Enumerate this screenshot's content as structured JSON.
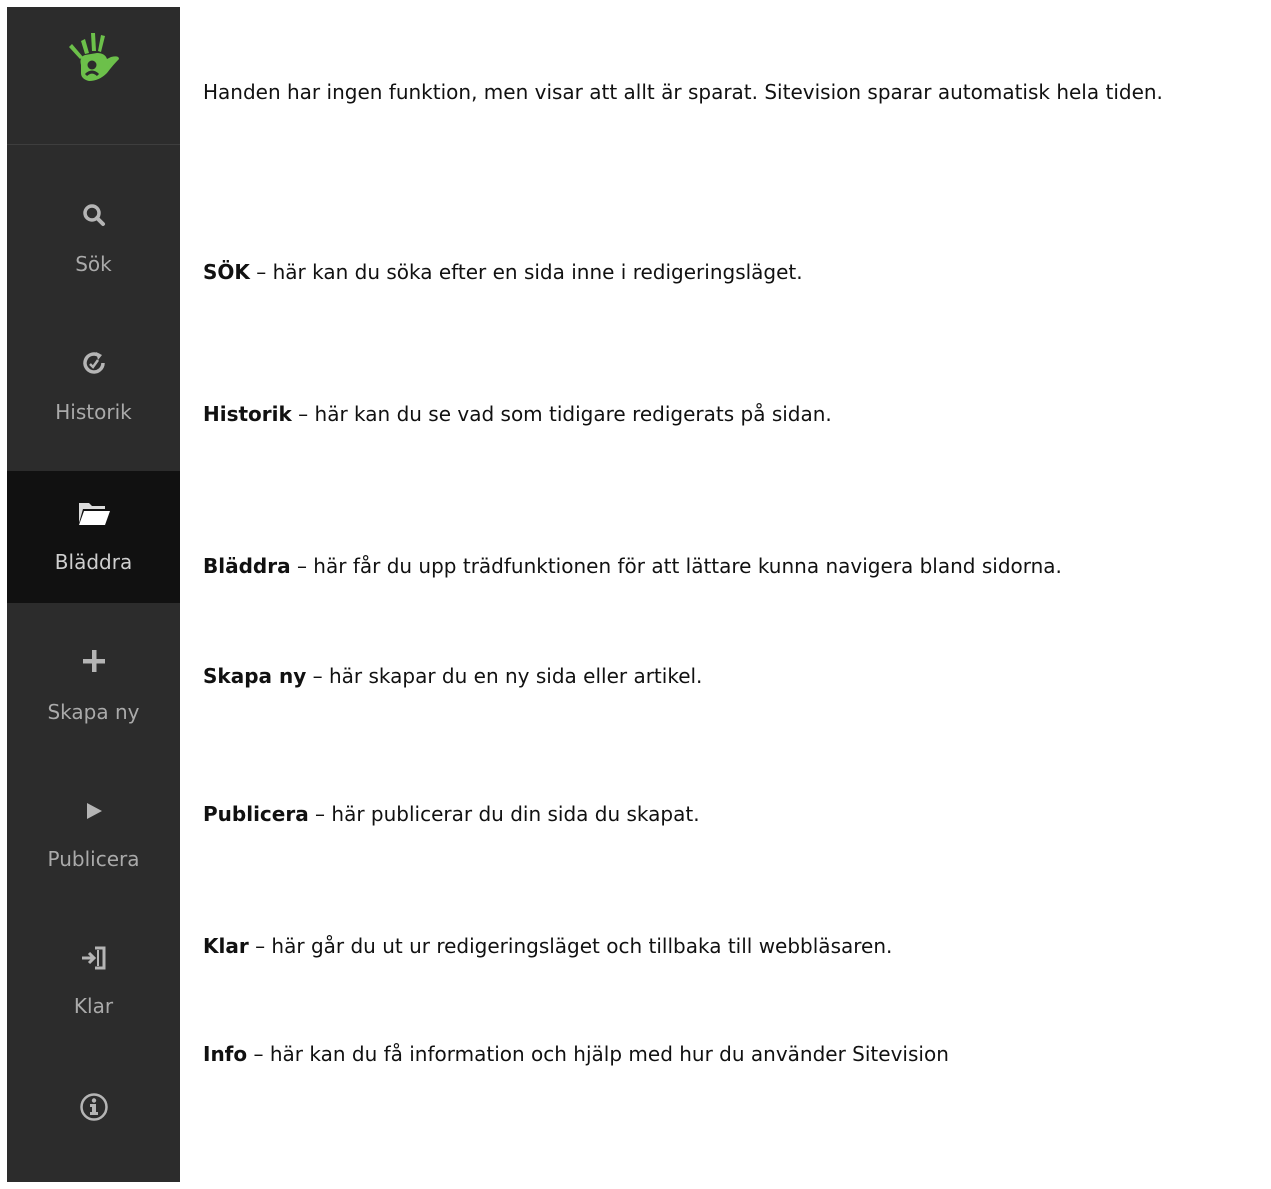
{
  "sidebar": {
    "logo": {
      "icon": "hand-icon",
      "color": "#6cc04a"
    },
    "items": [
      {
        "key": "sok",
        "label": "Sök",
        "icon": "search-icon"
      },
      {
        "key": "historik",
        "label": "Historik",
        "icon": "history-icon"
      },
      {
        "key": "bladdra",
        "label": "Bläddra",
        "icon": "folder-open-icon",
        "active": true
      },
      {
        "key": "skapa",
        "label": "Skapa ny",
        "icon": "plus-icon"
      },
      {
        "key": "publicera",
        "label": "Publicera",
        "icon": "play-icon"
      },
      {
        "key": "klar",
        "label": "Klar",
        "icon": "exit-icon"
      },
      {
        "key": "info",
        "label": "",
        "icon": "info-icon"
      }
    ]
  },
  "descriptions": {
    "hand": {
      "text": "Handen har ingen funktion, men visar att allt är sparat. Sitevision sparar automatisk hela tiden."
    },
    "sok": {
      "term": "SÖK",
      "text": " – här kan du söka efter en sida inne i redigeringsläget."
    },
    "historik": {
      "term": "Historik",
      "text": " – här kan du se vad som tidigare redigerats på sidan."
    },
    "bladdra": {
      "term": "Bläddra",
      "text": " – här får du upp trädfunktionen för att lättare kunna navigera bland sidorna."
    },
    "skapa": {
      "term": "Skapa ny",
      "text": " – här skapar du en ny sida eller artikel."
    },
    "publicera": {
      "term": "Publicera",
      "text": " – här publicerar du din sida du skapat."
    },
    "klar": {
      "term": "Klar",
      "text": " – här går du ut ur redigeringsläget och tillbaka till webbläsaren."
    },
    "info": {
      "term": "Info",
      "text": " – här kan du få information och hjälp med hur du använder Sitevision"
    }
  },
  "colors": {
    "sidebar_bg": "#2c2c2c",
    "sidebar_active_bg": "#111111",
    "icon": "#b5b5b5",
    "label": "#aaaaaa",
    "logo": "#6cc04a"
  }
}
